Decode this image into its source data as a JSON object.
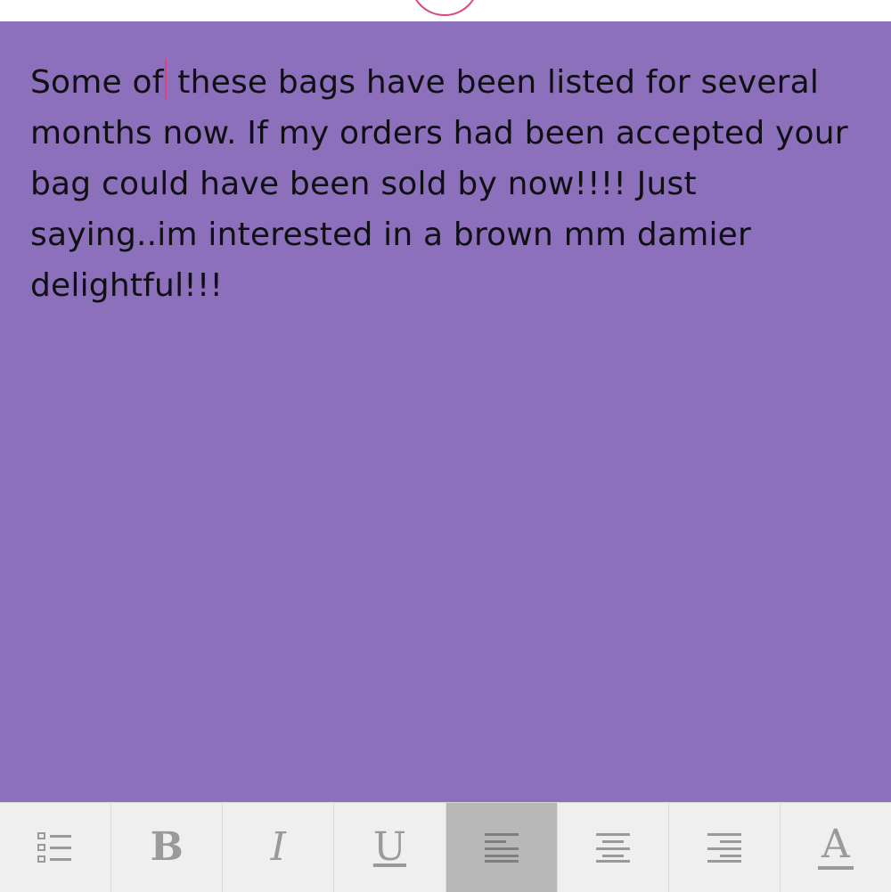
{
  "note": {
    "text_before_caret": "Some of",
    "text_after_caret": " these bags have been listed for several months now. If my orders had been accepted your bag could have been sold by now!!!! Just saying..im interested in a brown mm damier delightful!!!",
    "background_color": "#8c70bc",
    "caret_color": "#e0427f"
  },
  "toolbar": {
    "bold_label": "B",
    "italic_label": "I",
    "underline_label": "U",
    "font_color_label": "A",
    "active_tool": "align-left",
    "icons": [
      "list-icon",
      "bold-icon",
      "italic-icon",
      "underline-icon",
      "align-left-icon",
      "align-center-icon",
      "align-right-icon",
      "font-color-icon"
    ]
  }
}
